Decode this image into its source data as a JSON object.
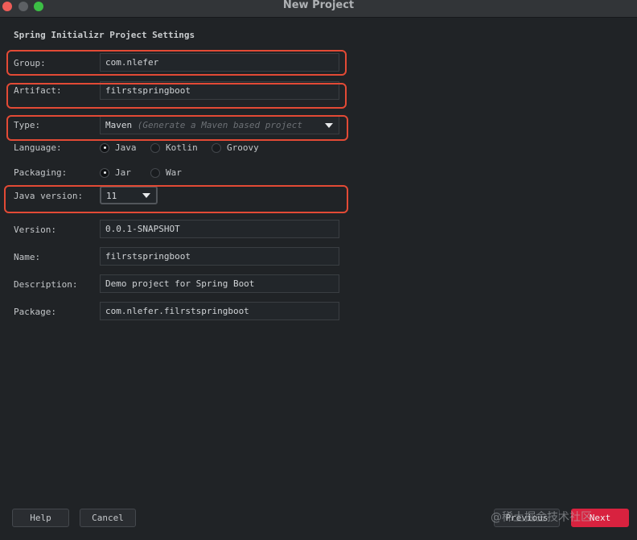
{
  "window": {
    "title": "New Project"
  },
  "section_title": "Spring Initializr Project Settings",
  "form": {
    "group_label": "Group:",
    "group_value": "com.nlefer",
    "artifact_label": "Artifact:",
    "artifact_value": "filrstspringboot",
    "type_label": "Type:",
    "type_value": "Maven",
    "type_hint": "(Generate a Maven based project",
    "language_label": "Language:",
    "language_options": [
      "Java",
      "Kotlin",
      "Groovy"
    ],
    "language_selected": "Java",
    "packaging_label": "Packaging:",
    "packaging_options": [
      "Jar",
      "War"
    ],
    "packaging_selected": "Jar",
    "java_version_label": "Java version:",
    "java_version_value": "11",
    "version_label": "Version:",
    "version_value": "0.0.1-SNAPSHOT",
    "name_label": "Name:",
    "name_value": "filrstspringboot",
    "description_label": "Description:",
    "description_value": "Demo project for Spring Boot",
    "package_label": "Package:",
    "package_value": "com.nlefer.filrstspringboot"
  },
  "buttons": {
    "help": "Help",
    "cancel": "Cancel",
    "previous": "Previous",
    "next": "Next"
  },
  "watermark": "@稀土掘金技术社区",
  "colors": {
    "background": "#202326",
    "highlight": "#e34a35",
    "next_button": "#d8223f",
    "close": "#ee5d58",
    "zoom": "#3cbe45"
  }
}
